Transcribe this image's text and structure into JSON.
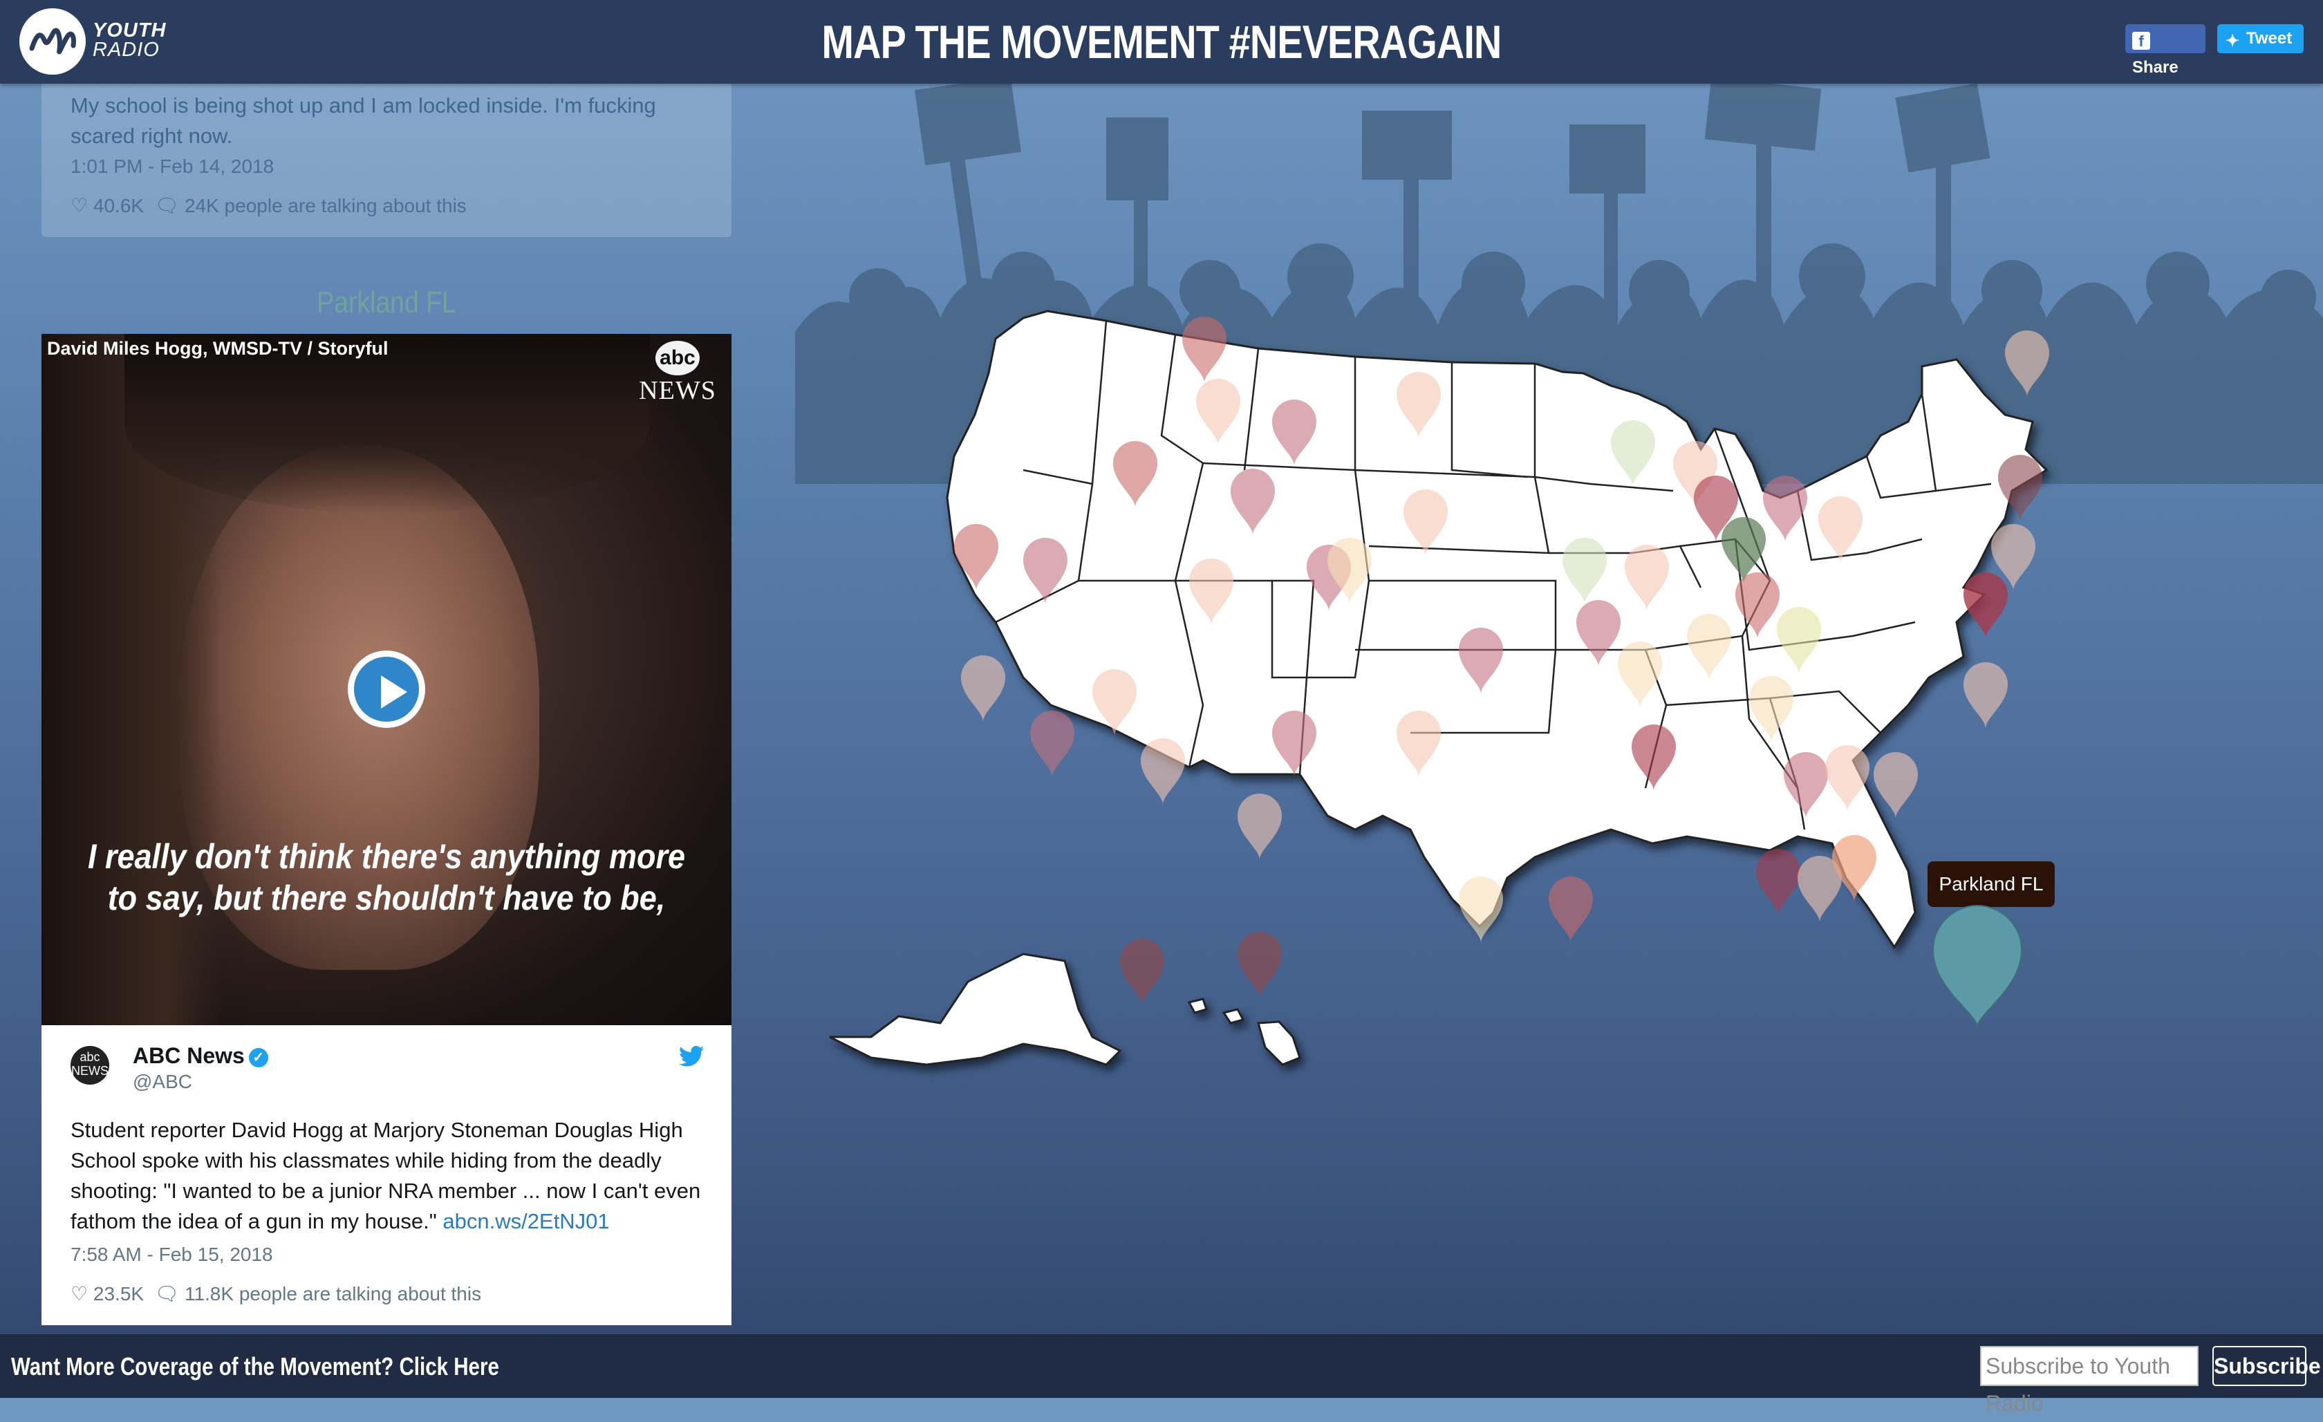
{
  "header": {
    "logo_text_line1": "YOUTH",
    "logo_text_line2": "RADIO",
    "title": "MAP THE MOVEMENT #NEVERAGAIN",
    "share_label": "Share",
    "tweet_label": "Tweet"
  },
  "faded_tweet": {
    "text": "My school is being shot up and I am locked inside. I'm fucking scared right now.",
    "timestamp": "1:01 PM - Feb 14, 2018",
    "likes": "40.6K",
    "talking": "24K people are talking about this"
  },
  "location_label": "Parkland FL",
  "video": {
    "credit": "David Miles Hogg, WMSD-TV / Storyful",
    "network_logo": "abc",
    "network_news": "NEWS",
    "caption_line1": "I really don't think there's anything more",
    "caption_line2": "to say, but there shouldn't have to be,"
  },
  "tweet": {
    "avatar_text": "abc NEWS",
    "name": "ABC News",
    "handle": "@ABC",
    "text": "Student reporter David Hogg at Marjory Stoneman Douglas High School spoke with his classmates while hiding from the deadly shooting: \"I wanted to be a junior NRA member ... now I can't even fathom the idea of a gun in my house.\"",
    "link": "abcn.ws/2EtNJ01",
    "timestamp": "7:58 AM - Feb 15, 2018",
    "likes": "23.5K",
    "talking": "11.8K people are talking about this"
  },
  "map": {
    "tooltip": "Parkland FL",
    "selected_pin_color": "#5b9aa6",
    "pin_colors": [
      "#f4c7b0",
      "#d88a96",
      "#c4717f",
      "#f7dfb8",
      "#cfe3b9",
      "#c96a6a",
      "#a8394b",
      "#8a4a4e",
      "#f0a27f"
    ]
  },
  "footer": {
    "cta": "Want More Coverage of the Movement? Click Here",
    "subscribe_placeholder": "Subscribe to Youth Radio",
    "subscribe_button": "Subscribe"
  },
  "colors": {
    "header_bg": "#2a3d5f",
    "footer_bg": "#1f2c44",
    "accent_blue": "#2f86c8"
  }
}
